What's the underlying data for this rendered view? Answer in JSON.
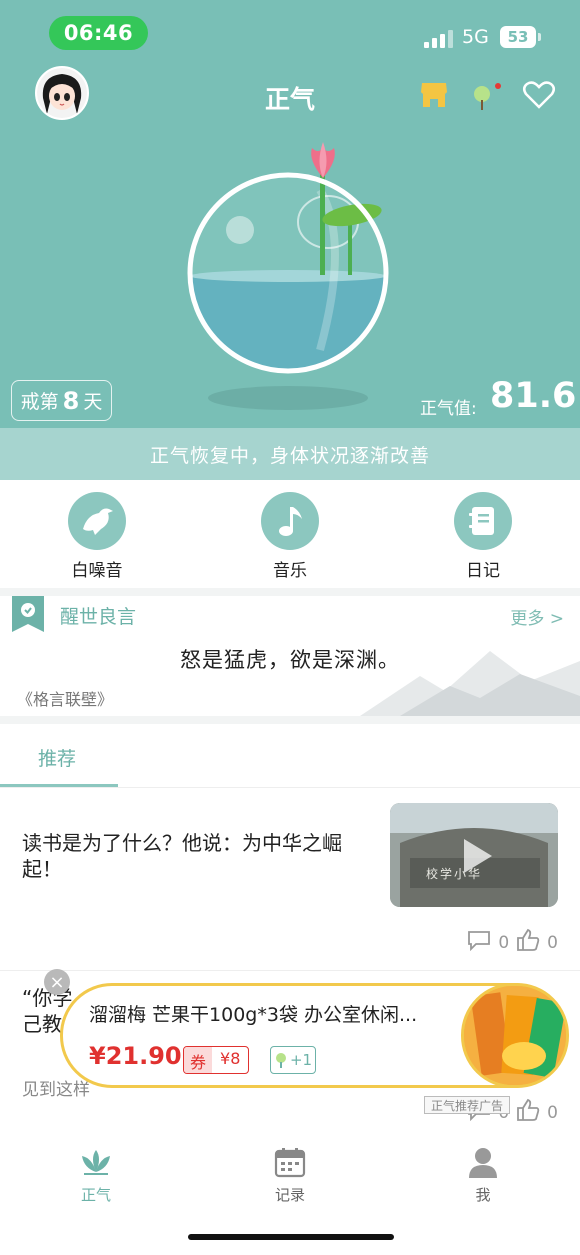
{
  "status_bar": {
    "time": "06:46",
    "network": "5G",
    "battery": "53"
  },
  "header": {
    "title": "正气"
  },
  "hero": {
    "days_prefix": "戒第",
    "days_value": "8",
    "days_suffix": "天",
    "qi_label": "正气值:",
    "qi_value": "81.6",
    "status_message": "正气恢复中，身体状况逐渐改善"
  },
  "tools": [
    {
      "label": "白噪音",
      "icon": "bird-icon"
    },
    {
      "label": "音乐",
      "icon": "music-note-icon"
    },
    {
      "label": "日记",
      "icon": "notebook-icon"
    }
  ],
  "quote": {
    "title": "醒世良言",
    "more": "更多 >",
    "text": "怒是猛虎，欲是深渊。",
    "source": "《格言联壁》"
  },
  "tabs": {
    "recommended": "推荐"
  },
  "feed": [
    {
      "headline": "读书是为了什么？他说：为中华之崛起！",
      "comments": "0",
      "likes": "0",
      "thumb_text": "校学小华"
    },
    {
      "headline_line1": "“你学",
      "headline_line2": "己教",
      "excerpt": "见到这样",
      "comments": "0",
      "likes": "0"
    }
  ],
  "ad": {
    "title": "溜溜梅 芒果干100g*3袋 办公室休闲...",
    "price": "¥21.90",
    "coupon_label": "券",
    "coupon_value": "¥8",
    "plus": "+1",
    "tag": "正气推荐广告",
    "close": "×"
  },
  "bottom_nav": [
    {
      "label": "正气",
      "icon": "lotus-icon",
      "active": true
    },
    {
      "label": "记录",
      "icon": "calendar-icon",
      "active": false
    },
    {
      "label": "我",
      "icon": "person-icon",
      "active": false
    }
  ],
  "colors": {
    "teal": "#79bfb6",
    "accent": "#6cb2a8",
    "price": "#e0312f",
    "ad_border": "#f2c94c"
  }
}
